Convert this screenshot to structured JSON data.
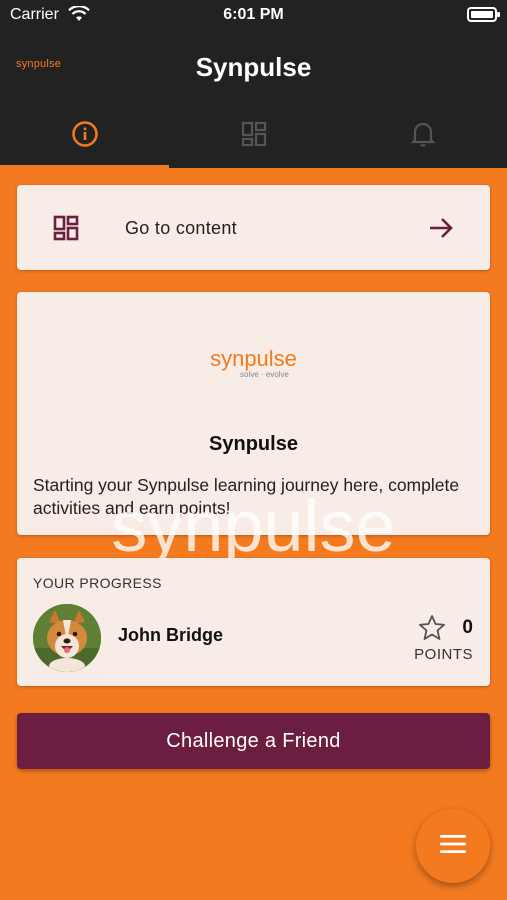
{
  "status_bar": {
    "carrier": "Carrier",
    "time": "6:01 PM"
  },
  "app_bar": {
    "logo_text": "synpulse",
    "title": "Synpulse",
    "tabs": [
      {
        "icon": "info-icon",
        "active": true
      },
      {
        "icon": "dashboard-grid-icon",
        "active": false
      },
      {
        "icon": "bell-icon",
        "active": false
      }
    ]
  },
  "goto_card": {
    "label": "Go to content",
    "icon": "dashboard-grid-icon",
    "arrow_icon": "arrow-right-icon"
  },
  "intro_card": {
    "brand_text": "synpulse",
    "brand_tagline": "solve · evolve",
    "heading": "Synpulse",
    "description": "Starting your Synpulse learning journey here, complete activities and earn points!"
  },
  "watermark": {
    "text": "synpulse",
    "tagline": "solve · evolve"
  },
  "progress_card": {
    "section_label": "YOUR PROGRESS",
    "user_name": "John Bridge",
    "points_value": "0",
    "points_label": "POINTS"
  },
  "challenge_button": {
    "label": "Challenge a Friend"
  },
  "fab": {
    "icon": "menu-icon"
  },
  "colors": {
    "accent": "#f47a20",
    "dark": "#222222",
    "card": "#f7ece6",
    "button": "#6b1e3f"
  }
}
